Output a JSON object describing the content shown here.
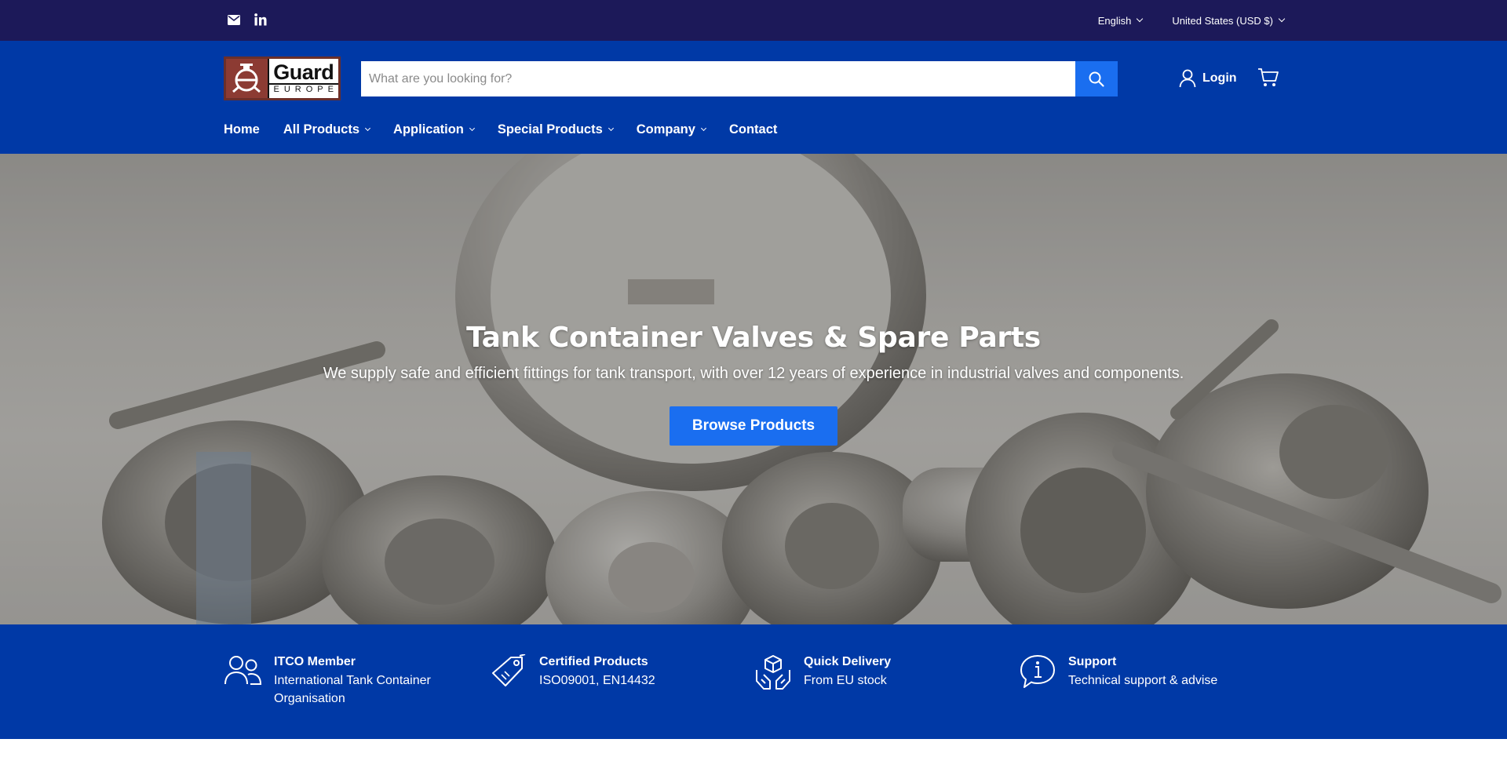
{
  "topbar": {
    "icons": [
      "mail-icon",
      "linkedin-icon"
    ],
    "language": "English",
    "currency": "United States (USD $)"
  },
  "header": {
    "logo": {
      "word": "Guard",
      "sub": "EUROPE"
    },
    "search_placeholder": "What are you looking for?",
    "login_label": "Login",
    "nav": [
      {
        "label": "Home",
        "dropdown": false
      },
      {
        "label": "All Products",
        "dropdown": true
      },
      {
        "label": "Application",
        "dropdown": true
      },
      {
        "label": "Special Products",
        "dropdown": true
      },
      {
        "label": "Company",
        "dropdown": true
      },
      {
        "label": "Contact",
        "dropdown": false
      }
    ]
  },
  "hero": {
    "title": "Tank Container Valves & Spare Parts",
    "subtitle": "We supply safe and efficient fittings for tank transport, with over 12 years of experience in industrial valves and components.",
    "cta_label": "Browse Products"
  },
  "features": [
    {
      "icon": "users-icon",
      "title": "ITCO Member",
      "desc": "International Tank Container Organisation"
    },
    {
      "icon": "tag-icon",
      "title": "Certified Products",
      "desc": "ISO09001, EN14432"
    },
    {
      "icon": "package-hands-icon",
      "title": "Quick Delivery",
      "desc": "From EU stock"
    },
    {
      "icon": "info-bubble-icon",
      "title": "Support",
      "desc": "Technical support & advise"
    }
  ],
  "colors": {
    "topbar": "#1c1959",
    "header": "#0039a6",
    "accent": "#1a6ef0"
  }
}
